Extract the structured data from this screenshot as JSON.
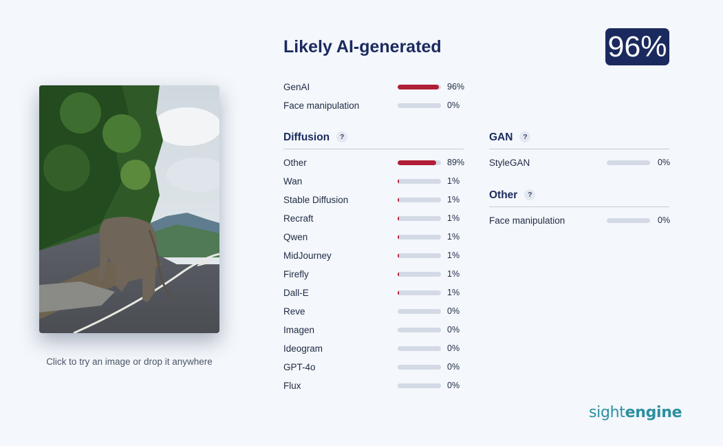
{
  "verdict": "Likely AI-generated",
  "score": "96%",
  "hint": "Click to try an image or drop it anywhere",
  "logo": {
    "part1": "sight",
    "part2": "engine"
  },
  "colors": {
    "accent": "#b01e37",
    "navy": "#1b2a5e",
    "bar_bg": "#d3dae5",
    "logo": "#2b8fa0"
  },
  "summary": [
    {
      "label": "GenAI",
      "pct": "96%",
      "value": 0.96
    },
    {
      "label": "Face manipulation",
      "pct": "0%",
      "value": 0
    }
  ],
  "sections": {
    "diffusion": {
      "title": "Diffusion",
      "help": "?",
      "items": [
        {
          "label": "Other",
          "pct": "89%",
          "value": 0.89
        },
        {
          "label": "Wan",
          "pct": "1%",
          "value": 0.01
        },
        {
          "label": "Stable Diffusion",
          "pct": "1%",
          "value": 0.01
        },
        {
          "label": "Recraft",
          "pct": "1%",
          "value": 0.01
        },
        {
          "label": "Qwen",
          "pct": "1%",
          "value": 0.01
        },
        {
          "label": "MidJourney",
          "pct": "1%",
          "value": 0.01
        },
        {
          "label": "Firefly",
          "pct": "1%",
          "value": 0.01
        },
        {
          "label": "Dall-E",
          "pct": "1%",
          "value": 0.01
        },
        {
          "label": "Reve",
          "pct": "0%",
          "value": 0
        },
        {
          "label": "Imagen",
          "pct": "0%",
          "value": 0
        },
        {
          "label": "Ideogram",
          "pct": "0%",
          "value": 0
        },
        {
          "label": "GPT-4o",
          "pct": "0%",
          "value": 0
        },
        {
          "label": "Flux",
          "pct": "0%",
          "value": 0
        }
      ]
    },
    "gan": {
      "title": "GAN",
      "help": "?",
      "items": [
        {
          "label": "StyleGAN",
          "pct": "0%",
          "value": 0
        }
      ]
    },
    "other": {
      "title": "Other",
      "help": "?",
      "items": [
        {
          "label": "Face manipulation",
          "pct": "0%",
          "value": 0
        }
      ]
    }
  }
}
